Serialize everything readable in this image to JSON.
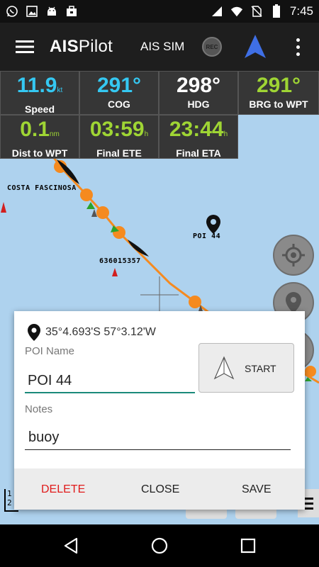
{
  "status_bar": {
    "time": "7:45",
    "left_icons": [
      "whatsapp-icon",
      "image-icon",
      "android-icon",
      "briefcase-icon"
    ],
    "right_icons": [
      "signal-icon",
      "wifi-icon",
      "no-sim-icon",
      "battery-icon"
    ]
  },
  "app_bar": {
    "title_bold": "AIS",
    "title_rest": "Pilot",
    "mode": "AIS SIM",
    "rec_label": "REC"
  },
  "instruments": [
    {
      "value": "11.9",
      "unit": "kt",
      "label": "Speed",
      "color": "#35c8f2"
    },
    {
      "value": "291°",
      "unit": "",
      "label": "COG",
      "color": "#35c8f2"
    },
    {
      "value": "298°",
      "unit": "",
      "label": "HDG",
      "color": "#ffffff"
    },
    {
      "value": "291°",
      "unit": "",
      "label": "BRG to WPT",
      "color": "#9fd534"
    },
    {
      "value": "0.1",
      "unit": "nm",
      "label": "Dist to WPT",
      "color": "#9fd534"
    },
    {
      "value": "03:59",
      "unit": "h",
      "label": "Final ETE",
      "color": "#9fd534"
    },
    {
      "value": "23:44",
      "unit": "h",
      "label": "Final ETA",
      "color": "#9fd534"
    }
  ],
  "map": {
    "labels": {
      "costa": "COSTA FASCINOSA",
      "poi": "POI 44",
      "mmsi": "636015357"
    },
    "scale": "1\n2"
  },
  "dialog": {
    "coordinates": "35°4.693'S 57°3.12'W",
    "poi_name_label": "POI Name",
    "poi_name_value": "POI 44",
    "notes_label": "Notes",
    "notes_value": "buoy",
    "start_label": "START",
    "delete_label": "DELETE",
    "close_label": "CLOSE",
    "save_label": "SAVE"
  },
  "colors": {
    "accent": "#1a8a7a",
    "delete": "#e01b1b",
    "route": "#f58a1f",
    "map_water": "#aed2ee"
  }
}
